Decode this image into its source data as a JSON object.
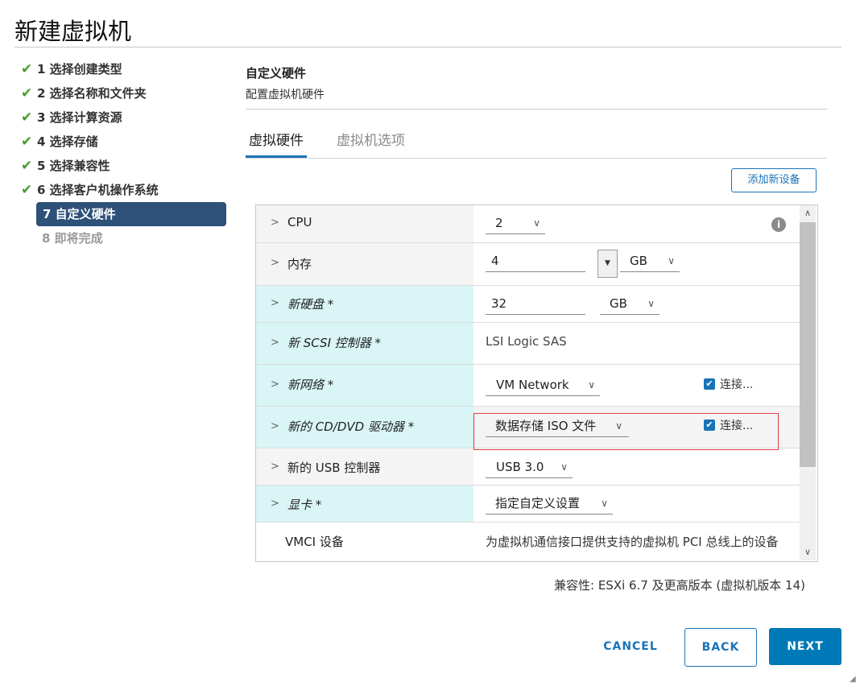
{
  "window": {
    "title": "新建虚拟机"
  },
  "steps": [
    {
      "label": "1 选择创建类型",
      "state": "done"
    },
    {
      "label": "2 选择名称和文件夹",
      "state": "done"
    },
    {
      "label": "3 选择计算资源",
      "state": "done"
    },
    {
      "label": "4 选择存储",
      "state": "done"
    },
    {
      "label": "5 选择兼容性",
      "state": "done"
    },
    {
      "label": "6 选择客户机操作系统",
      "state": "done"
    },
    {
      "label": "7 自定义硬件",
      "state": "active"
    },
    {
      "label": "8 即将完成",
      "state": "disabled"
    }
  ],
  "section": {
    "title": "自定义硬件",
    "subtitle": "配置虚拟机硬件"
  },
  "tabs": [
    {
      "label": "虚拟硬件",
      "active": true
    },
    {
      "label": "虚拟机选项",
      "active": false
    }
  ],
  "add_device_button": "添加新设备",
  "hardware": {
    "cpu": {
      "label": "CPU",
      "value": "2"
    },
    "memory": {
      "label": "内存",
      "value": "4",
      "unit": "GB"
    },
    "disk": {
      "label": "新硬盘 *",
      "value": "32",
      "unit": "GB"
    },
    "scsi": {
      "label": "新 SCSI 控制器 *",
      "value": "LSI Logic SAS"
    },
    "network": {
      "label": "新网络 *",
      "value": "VM Network",
      "connect_label": "连接...",
      "connected": true
    },
    "cdrom": {
      "label": "新的 CD/DVD 驱动器 *",
      "value": "数据存储 ISO 文件",
      "connect_label": "连接...",
      "connected": true
    },
    "usb": {
      "label": "新的 USB 控制器",
      "value": "USB 3.0"
    },
    "video": {
      "label": "显卡 *",
      "value": "指定自定义设置"
    },
    "vmci": {
      "label": "VMCI 设备",
      "value": "为虚拟机通信接口提供支持的虚拟机 PCI 总线上的设备"
    }
  },
  "compatibility": "兼容性: ESXi 6.7 及更高版本 (虚拟机版本 14)",
  "buttons": {
    "cancel": "CANCEL",
    "back": "BACK",
    "next": "NEXT"
  },
  "icons": {
    "check": "check-icon",
    "chevron": "chevron-right-icon",
    "dropdown": "chevron-down-icon",
    "info": "info-icon",
    "decrement": "triangle-down-icon"
  },
  "colors": {
    "accent": "#1a73b8",
    "active_step": "#2d5179",
    "check": "#4a9a2e",
    "highlight": "#d9f5f5",
    "error_outline": "#e04040"
  }
}
